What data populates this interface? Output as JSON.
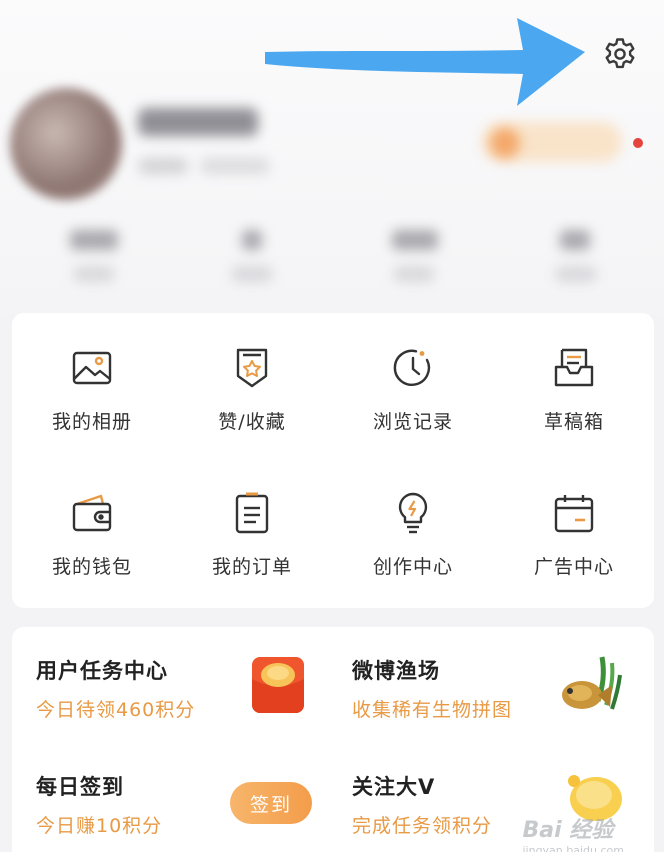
{
  "profile": {
    "settings_icon": "gear-icon",
    "has_notification_dot": true
  },
  "grid": [
    {
      "label": "我的相册",
      "icon": "photo-album-icon"
    },
    {
      "label": "赞/收藏",
      "icon": "star-bookmark-icon"
    },
    {
      "label": "浏览记录",
      "icon": "history-clock-icon"
    },
    {
      "label": "草稿箱",
      "icon": "draft-box-icon"
    },
    {
      "label": "我的钱包",
      "icon": "wallet-icon"
    },
    {
      "label": "我的订单",
      "icon": "order-list-icon"
    },
    {
      "label": "创作中心",
      "icon": "lightbulb-icon"
    },
    {
      "label": "广告中心",
      "icon": "calendar-ad-icon"
    }
  ],
  "tasks": {
    "user_task": {
      "title": "用户任务中心",
      "subtitle": "今日待领460积分"
    },
    "fishing": {
      "title": "微博渔场",
      "subtitle": "收集稀有生物拼图"
    },
    "checkin": {
      "title": "每日签到",
      "subtitle": "今日赚10积分",
      "button": "签到"
    },
    "follow": {
      "title": "关注大V",
      "subtitle": "完成任务领积分"
    }
  },
  "watermark": {
    "text": "Bai 经验",
    "sub": "jingyan.baidu.com"
  },
  "colors": {
    "accent": "#e89a45",
    "icon_stroke": "#333333",
    "arrow": "#4ba7ef",
    "badge_red": "#e6433e"
  }
}
